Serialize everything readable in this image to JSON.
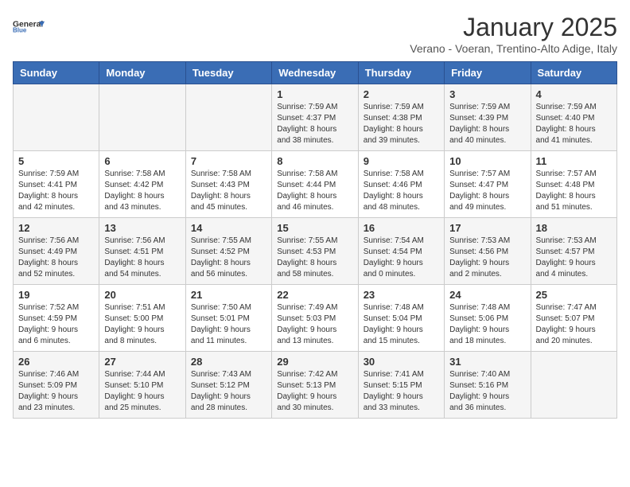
{
  "logo": {
    "general": "General",
    "blue": "Blue"
  },
  "header": {
    "month": "January 2025",
    "location": "Verano - Voeran, Trentino-Alto Adige, Italy"
  },
  "weekdays": [
    "Sunday",
    "Monday",
    "Tuesday",
    "Wednesday",
    "Thursday",
    "Friday",
    "Saturday"
  ],
  "weeks": [
    [
      {
        "day": "",
        "info": ""
      },
      {
        "day": "",
        "info": ""
      },
      {
        "day": "",
        "info": ""
      },
      {
        "day": "1",
        "info": "Sunrise: 7:59 AM\nSunset: 4:37 PM\nDaylight: 8 hours\nand 38 minutes."
      },
      {
        "day": "2",
        "info": "Sunrise: 7:59 AM\nSunset: 4:38 PM\nDaylight: 8 hours\nand 39 minutes."
      },
      {
        "day": "3",
        "info": "Sunrise: 7:59 AM\nSunset: 4:39 PM\nDaylight: 8 hours\nand 40 minutes."
      },
      {
        "day": "4",
        "info": "Sunrise: 7:59 AM\nSunset: 4:40 PM\nDaylight: 8 hours\nand 41 minutes."
      }
    ],
    [
      {
        "day": "5",
        "info": "Sunrise: 7:59 AM\nSunset: 4:41 PM\nDaylight: 8 hours\nand 42 minutes."
      },
      {
        "day": "6",
        "info": "Sunrise: 7:58 AM\nSunset: 4:42 PM\nDaylight: 8 hours\nand 43 minutes."
      },
      {
        "day": "7",
        "info": "Sunrise: 7:58 AM\nSunset: 4:43 PM\nDaylight: 8 hours\nand 45 minutes."
      },
      {
        "day": "8",
        "info": "Sunrise: 7:58 AM\nSunset: 4:44 PM\nDaylight: 8 hours\nand 46 minutes."
      },
      {
        "day": "9",
        "info": "Sunrise: 7:58 AM\nSunset: 4:46 PM\nDaylight: 8 hours\nand 48 minutes."
      },
      {
        "day": "10",
        "info": "Sunrise: 7:57 AM\nSunset: 4:47 PM\nDaylight: 8 hours\nand 49 minutes."
      },
      {
        "day": "11",
        "info": "Sunrise: 7:57 AM\nSunset: 4:48 PM\nDaylight: 8 hours\nand 51 minutes."
      }
    ],
    [
      {
        "day": "12",
        "info": "Sunrise: 7:56 AM\nSunset: 4:49 PM\nDaylight: 8 hours\nand 52 minutes."
      },
      {
        "day": "13",
        "info": "Sunrise: 7:56 AM\nSunset: 4:51 PM\nDaylight: 8 hours\nand 54 minutes."
      },
      {
        "day": "14",
        "info": "Sunrise: 7:55 AM\nSunset: 4:52 PM\nDaylight: 8 hours\nand 56 minutes."
      },
      {
        "day": "15",
        "info": "Sunrise: 7:55 AM\nSunset: 4:53 PM\nDaylight: 8 hours\nand 58 minutes."
      },
      {
        "day": "16",
        "info": "Sunrise: 7:54 AM\nSunset: 4:54 PM\nDaylight: 9 hours\nand 0 minutes."
      },
      {
        "day": "17",
        "info": "Sunrise: 7:53 AM\nSunset: 4:56 PM\nDaylight: 9 hours\nand 2 minutes."
      },
      {
        "day": "18",
        "info": "Sunrise: 7:53 AM\nSunset: 4:57 PM\nDaylight: 9 hours\nand 4 minutes."
      }
    ],
    [
      {
        "day": "19",
        "info": "Sunrise: 7:52 AM\nSunset: 4:59 PM\nDaylight: 9 hours\nand 6 minutes."
      },
      {
        "day": "20",
        "info": "Sunrise: 7:51 AM\nSunset: 5:00 PM\nDaylight: 9 hours\nand 8 minutes."
      },
      {
        "day": "21",
        "info": "Sunrise: 7:50 AM\nSunset: 5:01 PM\nDaylight: 9 hours\nand 11 minutes."
      },
      {
        "day": "22",
        "info": "Sunrise: 7:49 AM\nSunset: 5:03 PM\nDaylight: 9 hours\nand 13 minutes."
      },
      {
        "day": "23",
        "info": "Sunrise: 7:48 AM\nSunset: 5:04 PM\nDaylight: 9 hours\nand 15 minutes."
      },
      {
        "day": "24",
        "info": "Sunrise: 7:48 AM\nSunset: 5:06 PM\nDaylight: 9 hours\nand 18 minutes."
      },
      {
        "day": "25",
        "info": "Sunrise: 7:47 AM\nSunset: 5:07 PM\nDaylight: 9 hours\nand 20 minutes."
      }
    ],
    [
      {
        "day": "26",
        "info": "Sunrise: 7:46 AM\nSunset: 5:09 PM\nDaylight: 9 hours\nand 23 minutes."
      },
      {
        "day": "27",
        "info": "Sunrise: 7:44 AM\nSunset: 5:10 PM\nDaylight: 9 hours\nand 25 minutes."
      },
      {
        "day": "28",
        "info": "Sunrise: 7:43 AM\nSunset: 5:12 PM\nDaylight: 9 hours\nand 28 minutes."
      },
      {
        "day": "29",
        "info": "Sunrise: 7:42 AM\nSunset: 5:13 PM\nDaylight: 9 hours\nand 30 minutes."
      },
      {
        "day": "30",
        "info": "Sunrise: 7:41 AM\nSunset: 5:15 PM\nDaylight: 9 hours\nand 33 minutes."
      },
      {
        "day": "31",
        "info": "Sunrise: 7:40 AM\nSunset: 5:16 PM\nDaylight: 9 hours\nand 36 minutes."
      },
      {
        "day": "",
        "info": ""
      }
    ]
  ]
}
